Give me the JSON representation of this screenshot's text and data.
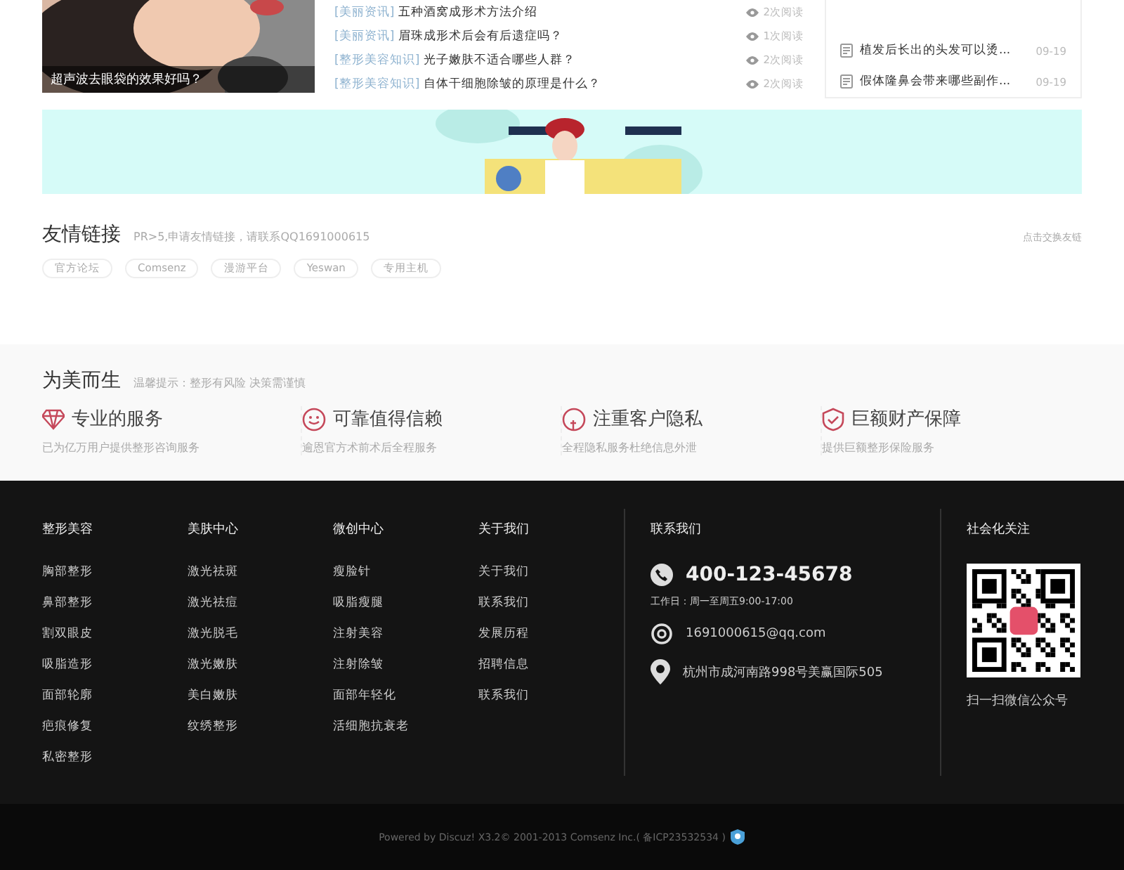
{
  "feature": {
    "caption": "超声波去眼袋的效果好吗？"
  },
  "articles": [
    {
      "tag": "[美丽资讯]",
      "title": "五种酒窝成形术方法介绍",
      "views": "2次阅读"
    },
    {
      "tag": "[美丽资讯]",
      "title": "眉珠成形术后会有后遗症吗？",
      "views": "1次阅读"
    },
    {
      "tag": "[整形美容知识]",
      "title": "光子嫩肤不适合哪些人群？",
      "views": "2次阅读"
    },
    {
      "tag": "[整形美容知识]",
      "title": "自体干细胞除皱的原理是什么？",
      "views": "2次阅读"
    }
  ],
  "side_list": [
    {
      "title": "植发后长出的头发可以烫...",
      "date": "09-19"
    },
    {
      "title": "假体隆鼻会带来哪些副作...",
      "date": "09-19"
    }
  ],
  "links": {
    "title": "友情链接",
    "note": "PR>5,申请友情链接，请联系QQ1691000615",
    "action": "点击交换友链",
    "items": [
      "官方论坛",
      "Comsenz",
      "漫游平台",
      "Yeswan",
      "专用主机"
    ]
  },
  "promise": {
    "title": "为美而生",
    "note": "温馨提示：整形有风险 决策需谨慎",
    "items": [
      {
        "title": "专业的服务",
        "desc": "已为亿万用户提供整形咨询服务"
      },
      {
        "title": "可靠值得信赖",
        "desc": "逾恩官方术前术后全程服务"
      },
      {
        "title": "注重客户隐私",
        "desc": "全程隐私服务杜绝信息外泄"
      },
      {
        "title": "巨额财产保障",
        "desc": "提供巨额整形保险服务"
      }
    ]
  },
  "footer": {
    "columns": [
      {
        "title": "整形美容",
        "items": [
          "胸部整形",
          "鼻部整形",
          "割双眼皮",
          "吸脂造形",
          "面部轮廓",
          "疤痕修复",
          "私密整形"
        ]
      },
      {
        "title": "美肤中心",
        "items": [
          "激光祛斑",
          "激光祛痘",
          "激光脱毛",
          "激光嫩肤",
          "美白嫩肤",
          "纹绣整形"
        ]
      },
      {
        "title": "微创中心",
        "items": [
          "瘦脸针",
          "吸脂瘦腿",
          "注射美容",
          "注射除皱",
          "面部年轻化",
          "活细胞抗衰老"
        ]
      },
      {
        "title": "关于我们",
        "items": [
          "关于我们",
          "联系我们",
          "发展历程",
          "招聘信息",
          "联系我们"
        ]
      }
    ],
    "contact": {
      "title": "联系我们",
      "phone": "400-123-45678",
      "hours": "工作日：周一至周五9:00-17:00",
      "email": "1691000615@qq.com",
      "address": "杭州市成河南路998号美赢国际505"
    },
    "social": {
      "title": "社会化关注",
      "caption": "扫一扫微信公众号"
    },
    "copyright": "Powered by Discuz! X3.2© 2001-2013 Comsenz Inc.( 备ICP23532534 )"
  }
}
